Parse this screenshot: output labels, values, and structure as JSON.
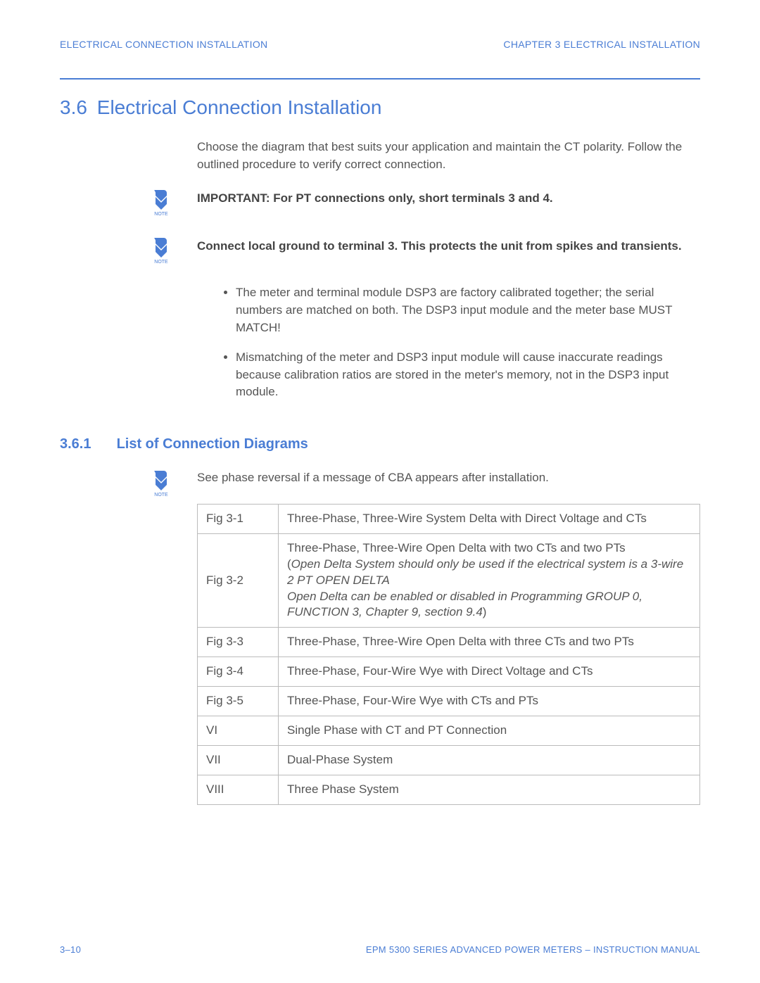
{
  "header": {
    "left": "ELECTRICAL CONNECTION INSTALLATION",
    "right": "CHAPTER 3  ELECTRICAL INSTALLATION"
  },
  "section": {
    "num": "3.6",
    "title": "Electrical Connection Installation",
    "intro": "Choose the diagram that best suits your application and maintain the CT polarity.  Follow the outlined procedure to verify correct connection.",
    "note1": "IMPORTANT: For PT connections only, short terminals 3 and 4.",
    "note2": "Connect local ground to terminal 3. This protects the unit from spikes and transients.",
    "bullet1": "The meter and terminal module DSP3 are factory calibrated together; the serial numbers are matched on both. The DSP3 input module and the meter base MUST MATCH!",
    "bullet2": "Mismatching of the meter and DSP3 input module will cause inaccurate readings because calibration ratios are stored in the meter's memory, not in the DSP3 input module."
  },
  "subsection": {
    "num": "3.6.1",
    "title": "List of Connection Diagrams",
    "note": "See phase reversal if a message of CBA appears after installation.",
    "rows": [
      {
        "id": "Fig 3-1",
        "desc": "Three-Phase, Three-Wire System Delta with Direct Voltage and CTs"
      },
      {
        "id": "Fig 3-2",
        "desc_line1": "Three-Phase, Three-Wire Open Delta with two CTs and two PTs",
        "desc_italic1_prefix": "(",
        "desc_italic1": "Open Delta System should only be used if the electrical system is a 3-wire 2 PT OPEN DELTA",
        "desc_italic2": "Open Delta can be enabled or disabled in Programming GROUP 0, FUNCTION 3, Chapter 9, section 9.4",
        "desc_italic2_suffix": ")"
      },
      {
        "id": "Fig 3-3",
        "desc": "Three-Phase, Three-Wire Open Delta with three CTs and two PTs"
      },
      {
        "id": "Fig 3-4",
        "desc": "Three-Phase, Four-Wire Wye with Direct Voltage and CTs"
      },
      {
        "id": "Fig 3-5",
        "desc": "Three-Phase, Four-Wire Wye with CTs and PTs"
      },
      {
        "id": "VI",
        "desc": "Single Phase with CT and PT Connection"
      },
      {
        "id": "VII",
        "desc": "Dual-Phase System"
      },
      {
        "id": "VIII",
        "desc": "Three Phase System"
      }
    ]
  },
  "footer": {
    "left": "3–10",
    "right": "EPM 5300 SERIES ADVANCED POWER METERS – INSTRUCTION MANUAL"
  },
  "icons": {
    "note_label": "NOTE"
  }
}
